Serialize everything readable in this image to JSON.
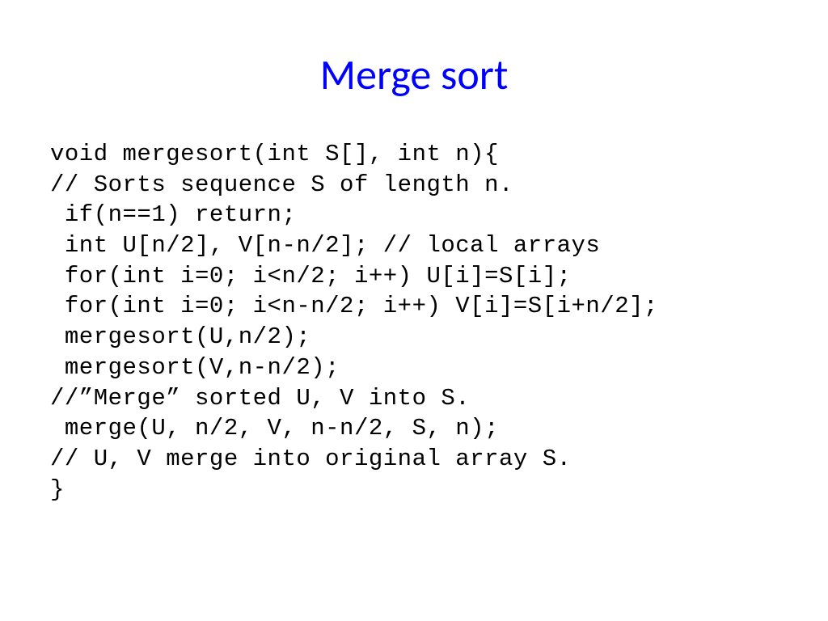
{
  "slide": {
    "title": "Merge sort",
    "code": "void mergesort(int S[], int n){\n// Sorts sequence S of length n.\n if(n==1) return;\n int U[n/2], V[n-n/2]; // local arrays\n for(int i=0; i<n/2; i++) U[i]=S[i];\n for(int i=0; i<n-n/2; i++) V[i]=S[i+n/2];\n mergesort(U,n/2);\n mergesort(V,n-n/2);\n//”Merge” sorted U, V into S.\n merge(U, n/2, V, n-n/2, S, n);\n// U, V merge into original array S.\n}"
  }
}
